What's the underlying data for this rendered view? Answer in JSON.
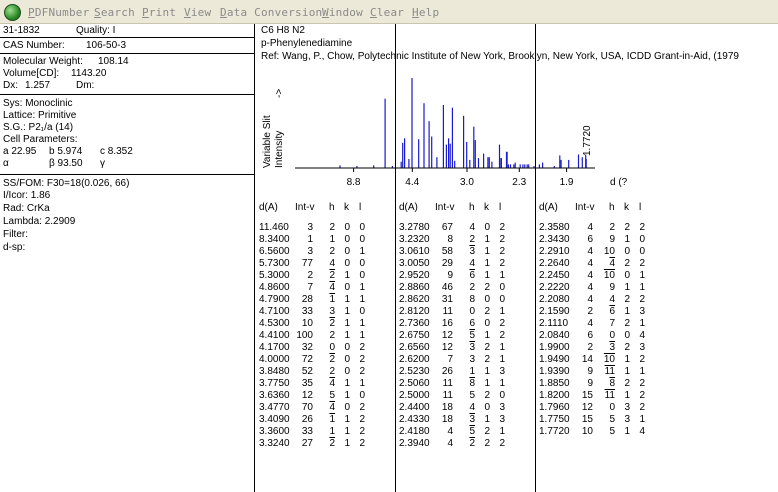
{
  "menu": {
    "items": [
      "PDFNumber",
      "Search",
      "Print",
      "View",
      "Data Conversion",
      "Window",
      "Clear",
      "Help"
    ]
  },
  "card": {
    "pdf_number": "31-1832",
    "quality": "Quality: I",
    "cas_label": "CAS Number:",
    "cas_value": "106-50-3",
    "mw_label": "Molecular Weight:",
    "mw_value": "108.14",
    "vol_label": "Volume[CD]:",
    "vol_value": "1143.20",
    "dx_label": "Dx:",
    "dx_value": "1.257",
    "dm_label": "Dm:",
    "sys": "Sys: Monoclinic",
    "lattice": "Lattice: Primitive",
    "sg": "S.G.: P2₁/a (14)",
    "cell_params": "Cell Parameters:",
    "a": "a  22.95",
    "b": "b  5.974",
    "c": "c  8.352",
    "alpha": "α",
    "beta": "β  93.50",
    "gamma": "γ",
    "ssfom": "SS/FOM: F30=18(0.026, 66)",
    "icor": "I/Icor:   1.86",
    "rad": "Rad: CrKa",
    "lambda": "Lambda: 2.2909",
    "filter": "Filter:",
    "dsp": "d-sp:"
  },
  "compound": {
    "formula": "C6 H8 N2",
    "name": "p-Phenylenediamine",
    "ref": "Ref: Wang, P., Chow, Polytechnic Institute of New York, Brooklyn, New York, USA, ICDD Grant-in-Aid, (1979"
  },
  "pattern": {
    "ylabel_1": "Variable Slit",
    "ylabel_2": "Intensity",
    "ylabel_arrow": "->",
    "xlabel": "d (?",
    "tick_labels": [
      "8.8",
      "4.4",
      "3.0",
      "2.3",
      "1.9"
    ],
    "peak_label": "1.7720"
  },
  "table_headers": {
    "d": "d(A)",
    "int": "Int-v",
    "h": "h",
    "k": "k",
    "l": "l"
  },
  "columns": [
    [
      [
        "11.460",
        "3",
        "2",
        "0",
        "0",
        0,
        0,
        0
      ],
      [
        "8.3400",
        "1",
        "1",
        "0",
        "0",
        0,
        0,
        0
      ],
      [
        "6.5600",
        "3",
        "2",
        "0",
        "1",
        0,
        0,
        0
      ],
      [
        "5.7300",
        "77",
        "4",
        "0",
        "0",
        0,
        0,
        0
      ],
      [
        "5.3000",
        "2",
        "2",
        "1",
        "0",
        1,
        0,
        0
      ],
      [
        "4.8600",
        "7",
        "4",
        "0",
        "1",
        1,
        0,
        0
      ],
      [
        "4.7900",
        "28",
        "1",
        "1",
        "1",
        1,
        0,
        0
      ],
      [
        "4.7100",
        "33",
        "3",
        "1",
        "0",
        0,
        0,
        0
      ],
      [
        "4.5300",
        "10",
        "2",
        "1",
        "1",
        1,
        0,
        0
      ],
      [
        "4.4100",
        "100",
        "2",
        "1",
        "1",
        0,
        0,
        0
      ],
      [
        "4.1700",
        "32",
        "0",
        "0",
        "2",
        0,
        0,
        0
      ],
      [
        "4.0000",
        "72",
        "2",
        "0",
        "2",
        1,
        0,
        0
      ],
      [
        "3.8480",
        "52",
        "2",
        "0",
        "2",
        0,
        0,
        0
      ],
      [
        "3.7750",
        "35",
        "4",
        "1",
        "1",
        1,
        0,
        0
      ],
      [
        "3.6360",
        "12",
        "5",
        "1",
        "0",
        0,
        0,
        0
      ],
      [
        "3.4770",
        "70",
        "4",
        "0",
        "2",
        1,
        0,
        0
      ],
      [
        "3.4090",
        "26",
        "1",
        "1",
        "2",
        1,
        0,
        0
      ],
      [
        "3.3600",
        "33",
        "1",
        "1",
        "2",
        0,
        0,
        0
      ],
      [
        "3.3240",
        "27",
        "2",
        "1",
        "2",
        1,
        0,
        0
      ]
    ],
    [
      [
        "3.2780",
        "67",
        "4",
        "0",
        "2",
        0,
        0,
        0
      ],
      [
        "3.2320",
        "8",
        "2",
        "1",
        "2",
        0,
        0,
        0
      ],
      [
        "3.0610",
        "58",
        "3",
        "1",
        "2",
        1,
        0,
        0
      ],
      [
        "3.0050",
        "29",
        "4",
        "1",
        "2",
        0,
        0,
        0
      ],
      [
        "2.9520",
        "9",
        "6",
        "1",
        "1",
        1,
        0,
        0
      ],
      [
        "2.8860",
        "46",
        "2",
        "2",
        "0",
        0,
        0,
        0
      ],
      [
        "2.8620",
        "31",
        "8",
        "0",
        "0",
        0,
        0,
        0
      ],
      [
        "2.8120",
        "11",
        "0",
        "2",
        "1",
        0,
        0,
        0
      ],
      [
        "2.7360",
        "16",
        "6",
        "0",
        "2",
        0,
        0,
        0
      ],
      [
        "2.6750",
        "12",
        "5",
        "1",
        "2",
        1,
        0,
        0
      ],
      [
        "2.6560",
        "12",
        "3",
        "2",
        "1",
        1,
        0,
        0
      ],
      [
        "2.6200",
        "7",
        "3",
        "2",
        "1",
        0,
        0,
        0
      ],
      [
        "2.5230",
        "26",
        "1",
        "1",
        "3",
        0,
        0,
        0
      ],
      [
        "2.5060",
        "11",
        "8",
        "1",
        "1",
        1,
        0,
        0
      ],
      [
        "2.5000",
        "11",
        "5",
        "2",
        "0",
        0,
        0,
        0
      ],
      [
        "2.4400",
        "18",
        "4",
        "0",
        "3",
        0,
        0,
        0
      ],
      [
        "2.4330",
        "18",
        "3",
        "1",
        "3",
        1,
        0,
        0
      ],
      [
        "2.4180",
        "4",
        "5",
        "2",
        "1",
        1,
        0,
        0
      ],
      [
        "2.3940",
        "4",
        "2",
        "2",
        "2",
        1,
        0,
        0
      ]
    ],
    [
      [
        "2.3580",
        "4",
        "2",
        "2",
        "2",
        0,
        0,
        0
      ],
      [
        "2.3430",
        "6",
        "9",
        "1",
        "0",
        0,
        0,
        0
      ],
      [
        "2.2910",
        "4",
        "10",
        "0",
        "0",
        0,
        0,
        0
      ],
      [
        "2.2640",
        "4",
        "4",
        "2",
        "2",
        1,
        0,
        0
      ],
      [
        "2.2450",
        "4",
        "10",
        "0",
        "1",
        1,
        0,
        0
      ],
      [
        "2.2220",
        "4",
        "9",
        "1",
        "1",
        0,
        0,
        0
      ],
      [
        "2.2080",
        "4",
        "4",
        "2",
        "2",
        0,
        0,
        0
      ],
      [
        "2.1590",
        "2",
        "6",
        "1",
        "3",
        1,
        0,
        0
      ],
      [
        "2.1110",
        "4",
        "7",
        "2",
        "1",
        0,
        0,
        0
      ],
      [
        "2.0840",
        "6",
        "0",
        "0",
        "4",
        0,
        0,
        0
      ],
      [
        "1.9900",
        "2",
        "3",
        "2",
        "3",
        1,
        0,
        0
      ],
      [
        "1.9490",
        "14",
        "10",
        "1",
        "2",
        1,
        0,
        0
      ],
      [
        "1.9390",
        "9",
        "11",
        "1",
        "1",
        1,
        0,
        0
      ],
      [
        "1.8850",
        "9",
        "8",
        "2",
        "2",
        1,
        0,
        0
      ],
      [
        "1.8200",
        "15",
        "11",
        "1",
        "2",
        1,
        0,
        0
      ],
      [
        "1.7960",
        "12",
        "0",
        "3",
        "2",
        0,
        0,
        0
      ],
      [
        "1.7750",
        "15",
        "5",
        "3",
        "1",
        0,
        0,
        0
      ],
      [
        "1.7720",
        "10",
        "5",
        "1",
        "4",
        0,
        0,
        0
      ]
    ]
  ],
  "chart_data": {
    "type": "bar",
    "xlabel": "d (?",
    "ylabel": "Variable Slit Intensity",
    "x_scale": "reciprocal d",
    "x_ticks": [
      8.8,
      4.4,
      3.0,
      2.3,
      1.9
    ],
    "annotations": [
      "1.7720"
    ],
    "peaks_d": [
      11.46,
      8.34,
      6.56,
      5.73,
      5.3,
      4.86,
      4.79,
      4.71,
      4.53,
      4.41,
      4.17,
      4.0,
      3.848,
      3.775,
      3.636,
      3.477,
      3.409,
      3.36,
      3.324,
      3.278,
      3.232,
      3.061,
      3.005,
      2.952,
      2.886,
      2.862,
      2.812,
      2.736,
      2.675,
      2.656,
      2.62,
      2.523,
      2.506,
      2.5,
      2.44,
      2.433,
      2.418,
      2.394,
      2.358,
      2.343,
      2.291,
      2.264,
      2.245,
      2.222,
      2.208,
      2.159,
      2.111,
      2.084,
      1.99,
      1.949,
      1.939,
      1.885,
      1.82,
      1.796,
      1.775,
      1.772
    ],
    "peaks_intensity": [
      3,
      1,
      3,
      77,
      2,
      7,
      28,
      33,
      10,
      100,
      32,
      72,
      52,
      35,
      12,
      70,
      26,
      33,
      27,
      67,
      8,
      58,
      29,
      9,
      46,
      31,
      11,
      16,
      12,
      12,
      7,
      26,
      11,
      11,
      18,
      18,
      4,
      4,
      4,
      6,
      4,
      4,
      4,
      4,
      4,
      2,
      4,
      6,
      2,
      14,
      9,
      9,
      15,
      12,
      15,
      10
    ]
  }
}
